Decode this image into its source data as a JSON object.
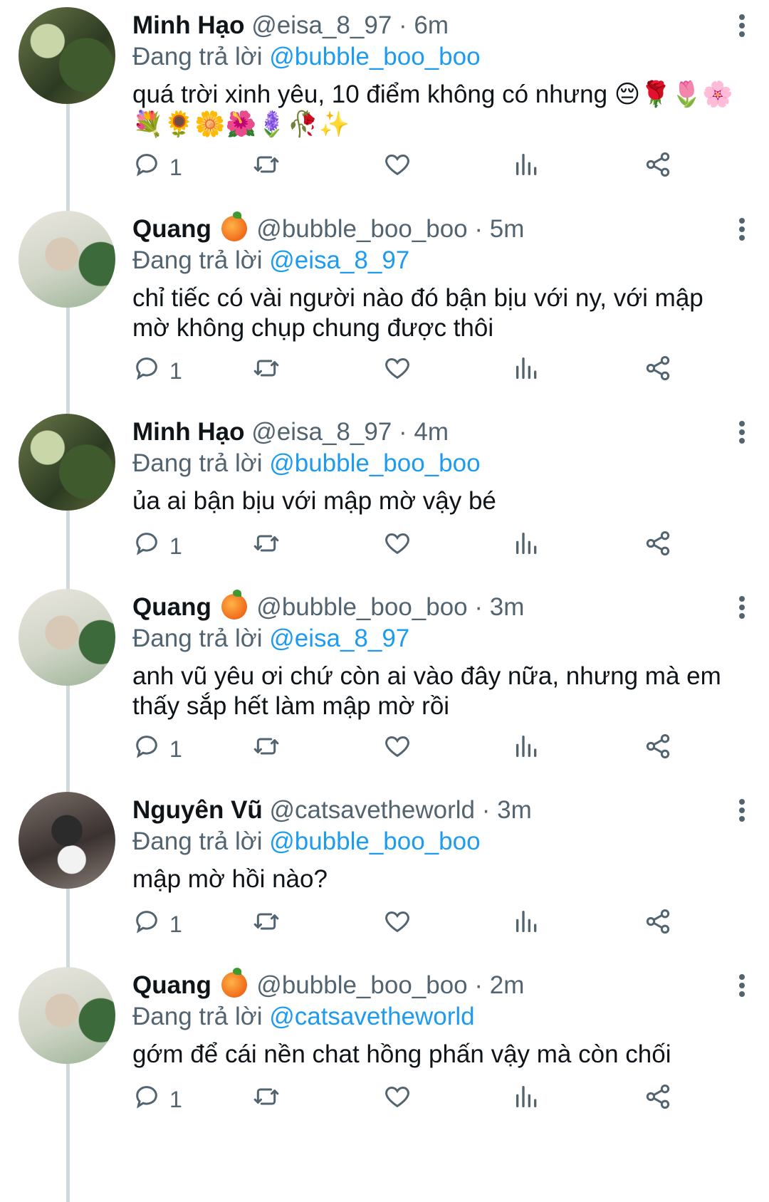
{
  "reply_prefix": "Đang trả lời",
  "tweets": [
    {
      "name": "Minh Hạo",
      "handle": "@eisa_8_97",
      "time": "· 6m",
      "reply_to": "@bubble_boo_boo",
      "text": "quá trời xinh yêu, 10 điểm không có nhưng 😔🌹🌷🌸💐🌻🌼🌺🪻🥀✨",
      "emoji_names": [
        "pensive-face",
        "rose",
        "tulip",
        "cherry-blossom",
        "bouquet",
        "sunflower",
        "blossom",
        "hibiscus",
        "hyacinth",
        "wilted-rose",
        "sparkles"
      ],
      "reply_count": "1",
      "has_orange": false,
      "avatar": "minh"
    },
    {
      "name": "Quang",
      "handle": "@bubble_boo_boo",
      "time": "· 5m",
      "reply_to": "@eisa_8_97",
      "text": "chỉ tiếc có vài người nào đó bận bịu với ny, với mập mờ không chụp chung được thôi",
      "reply_count": "1",
      "has_orange": true,
      "avatar": "quang"
    },
    {
      "name": "Minh Hạo",
      "handle": "@eisa_8_97",
      "time": "· 4m",
      "reply_to": "@bubble_boo_boo",
      "text": "ủa ai bận bịu với mập mờ vậy bé",
      "reply_count": "1",
      "has_orange": false,
      "avatar": "minh"
    },
    {
      "name": "Quang",
      "handle": "@bubble_boo_boo",
      "time": "· 3m",
      "reply_to": "@eisa_8_97",
      "text": "anh vũ yêu ơi chứ còn ai vào đây nữa, nhưng mà em thấy sắp hết làm mập mờ rồi",
      "reply_count": "1",
      "has_orange": true,
      "avatar": "quang"
    },
    {
      "name": "Nguyên Vũ",
      "handle": "@catsavetheworld",
      "time": "· 3m",
      "reply_to": "@bubble_boo_boo",
      "text": "mập mờ hồi nào?",
      "reply_count": "1",
      "has_orange": false,
      "avatar": "vu"
    },
    {
      "name": "Quang",
      "handle": "@bubble_boo_boo",
      "time": "· 2m",
      "reply_to": "@catsavetheworld",
      "text": "gớm để cái nền chat hồng phấn vậy mà còn chối",
      "reply_count": "1",
      "has_orange": true,
      "avatar": "quang"
    }
  ],
  "icons": {
    "reply": "reply-icon",
    "retweet": "retweet-icon",
    "like": "heart-icon",
    "views": "views-icon",
    "share": "share-icon",
    "more": "more-vertical-icon"
  }
}
